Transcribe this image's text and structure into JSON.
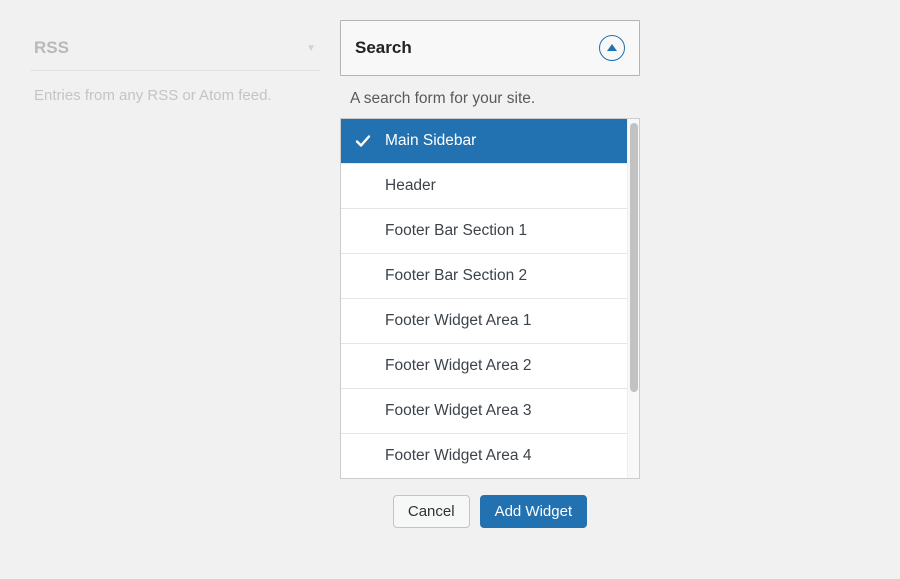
{
  "left_widget": {
    "title": "RSS",
    "description": "Entries from any RSS or Atom feed."
  },
  "right_widget": {
    "title": "Search",
    "description": "A search form for your site.",
    "areas": [
      {
        "label": "Main Sidebar",
        "selected": true
      },
      {
        "label": "Header",
        "selected": false
      },
      {
        "label": "Footer Bar Section 1",
        "selected": false
      },
      {
        "label": "Footer Bar Section 2",
        "selected": false
      },
      {
        "label": "Footer Widget Area 1",
        "selected": false
      },
      {
        "label": "Footer Widget Area 2",
        "selected": false
      },
      {
        "label": "Footer Widget Area 3",
        "selected": false
      },
      {
        "label": "Footer Widget Area 4",
        "selected": false
      }
    ],
    "cancel_label": "Cancel",
    "add_label": "Add Widget"
  }
}
